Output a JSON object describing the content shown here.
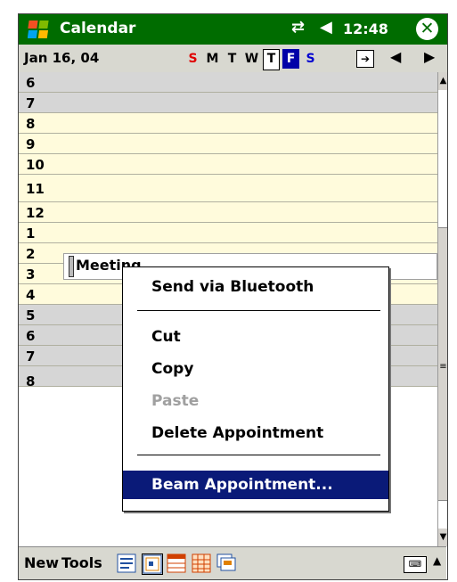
{
  "titlebar": {
    "title": "Calendar",
    "time": "12:48"
  },
  "datebar": {
    "date": "Jan 16, 04",
    "days": [
      {
        "label": "S",
        "kind": "sun"
      },
      {
        "label": "M",
        "kind": ""
      },
      {
        "label": "T",
        "kind": ""
      },
      {
        "label": "W",
        "kind": ""
      },
      {
        "label": "T",
        "kind": "thu"
      },
      {
        "label": "F",
        "kind": "fri"
      },
      {
        "label": "S",
        "kind": "sat"
      }
    ]
  },
  "hours": [
    {
      "label": "6",
      "kind": "off"
    },
    {
      "label": "7",
      "kind": "off"
    },
    {
      "label": "8",
      "kind": "work"
    },
    {
      "label": "9",
      "kind": "work"
    },
    {
      "label": "10",
      "kind": "work"
    },
    {
      "label": "11",
      "kind": "work"
    },
    {
      "label": "12",
      "kind": "work"
    },
    {
      "label": "1",
      "kind": "work"
    },
    {
      "label": "2",
      "kind": "work"
    },
    {
      "label": "3",
      "kind": "work"
    },
    {
      "label": "4",
      "kind": "work"
    },
    {
      "label": "5",
      "kind": "off"
    },
    {
      "label": "6",
      "kind": "off"
    },
    {
      "label": "7",
      "kind": "off"
    },
    {
      "label": "8",
      "kind": "off"
    }
  ],
  "appointment": {
    "title": "Meeting"
  },
  "context_menu": {
    "items": [
      {
        "label": "Send via Bluetooth",
        "state": "normal"
      },
      {
        "label": "Cut",
        "state": "normal"
      },
      {
        "label": "Copy",
        "state": "normal"
      },
      {
        "label": "Paste",
        "state": "disabled"
      },
      {
        "label": "Delete Appointment",
        "state": "normal"
      },
      {
        "label": "Beam Appointment...",
        "state": "selected"
      }
    ]
  },
  "toolbar": {
    "new_label": "New",
    "tools_label": "Tools"
  },
  "colors": {
    "titlebar": "#006c00",
    "work_hours": "#fffbdc",
    "off_hours": "#d6d6d6",
    "menu_highlight": "#0a1a78",
    "today": "#0000a8"
  }
}
